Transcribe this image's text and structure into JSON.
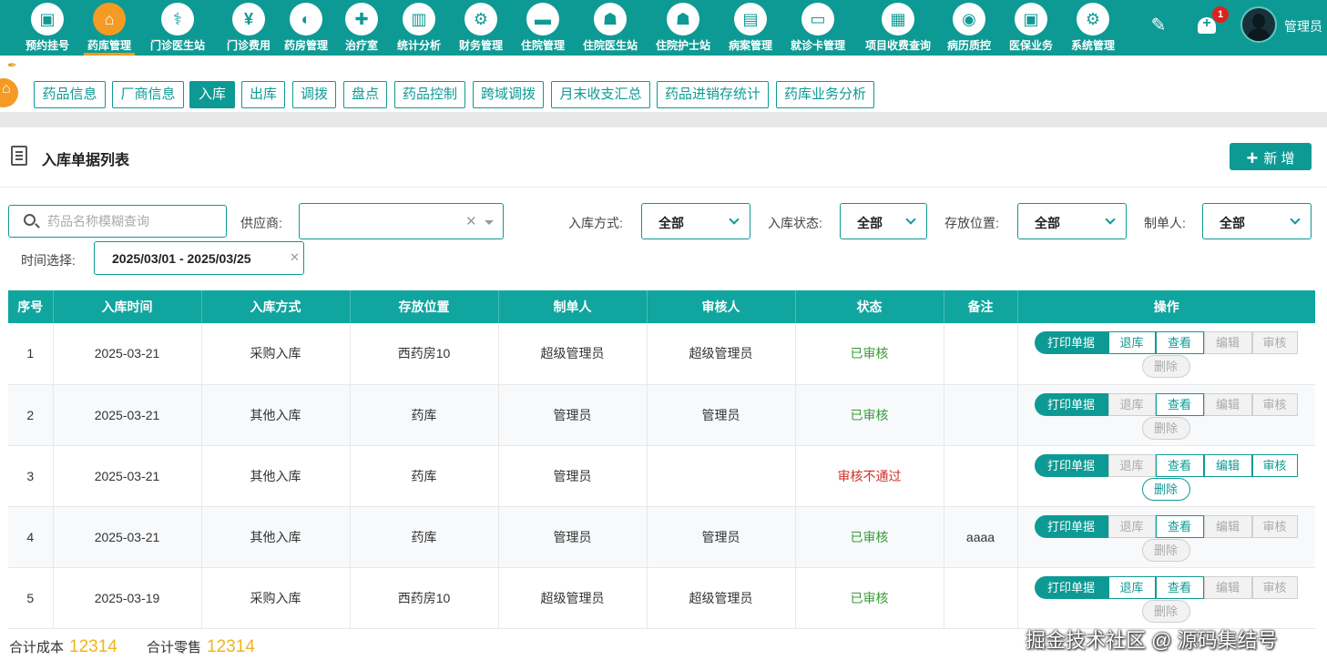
{
  "nav": {
    "items": [
      {
        "label": "预约挂号",
        "icon": "▣",
        "icon_name": "calendar-icon"
      },
      {
        "label": "药库管理",
        "icon": "⌂",
        "icon_name": "warehouse-icon",
        "active": true
      },
      {
        "label": "门诊医生站",
        "icon": "⚕",
        "icon_name": "doctor-icon"
      },
      {
        "label": "门诊费用",
        "icon": "¥",
        "icon_name": "yen-icon"
      },
      {
        "label": "药房管理",
        "icon": "◐",
        "icon_name": "pill-icon"
      },
      {
        "label": "治疗室",
        "icon": "✚",
        "icon_name": "treatment-icon"
      },
      {
        "label": "统计分析",
        "icon": "▥",
        "icon_name": "bar-chart-icon"
      },
      {
        "label": "财务管理",
        "icon": "⚙",
        "icon_name": "finance-gear-icon"
      },
      {
        "label": "住院管理",
        "icon": "▬",
        "icon_name": "bed-icon"
      },
      {
        "label": "住院医生站",
        "icon": "☗",
        "icon_name": "inpatient-doctor-icon"
      },
      {
        "label": "住院护士站",
        "icon": "☗",
        "icon_name": "nurse-icon"
      },
      {
        "label": "病案管理",
        "icon": "▤",
        "icon_name": "medical-record-icon"
      },
      {
        "label": "就诊卡管理",
        "icon": "▭",
        "icon_name": "card-icon"
      },
      {
        "label": "项目收费查询",
        "icon": "▦",
        "icon_name": "fee-query-icon"
      },
      {
        "label": "病历质控",
        "icon": "◉",
        "icon_name": "quality-control-icon"
      },
      {
        "label": "医保业务",
        "icon": "▣",
        "icon_name": "insurance-icon"
      },
      {
        "label": "系统管理",
        "icon": "⚙",
        "icon_name": "settings-icon"
      }
    ],
    "pencil_icon": "✎",
    "bell_badge": "1",
    "username": "管理员"
  },
  "subtabs": [
    {
      "label": "药品信息"
    },
    {
      "label": "厂商信息"
    },
    {
      "label": "入库",
      "active": true
    },
    {
      "label": "出库"
    },
    {
      "label": "调拨"
    },
    {
      "label": "盘点"
    },
    {
      "label": "药品控制"
    },
    {
      "label": "跨域调拨"
    },
    {
      "label": "月末收支汇总"
    },
    {
      "label": "药品进销存统计"
    },
    {
      "label": "药库业务分析"
    }
  ],
  "section": {
    "title": "入库单据列表",
    "add_label": "新 增"
  },
  "filters": {
    "search_placeholder": "药品名称模糊查询",
    "supplier_label": "供应商:",
    "supplier_value": "",
    "method_label": "入库方式:",
    "method_value": "全部",
    "status_label": "入库状态:",
    "status_value": "全部",
    "location_label": "存放位置:",
    "location_value": "全部",
    "creator_label": "制单人:",
    "creator_value": "全部",
    "date_label": "时间选择:",
    "date_value": "2025/03/01 - 2025/03/25"
  },
  "table": {
    "headers": [
      "序号",
      "入库时间",
      "入库方式",
      "存放位置",
      "制单人",
      "审核人",
      "状态",
      "备注",
      "操作"
    ],
    "ops_labels": {
      "print": "打印单据",
      "back": "退库",
      "view": "查看",
      "edit": "编辑",
      "audit": "审核",
      "del": "删除"
    },
    "rows": [
      {
        "no": "1",
        "time": "2025-03-21",
        "method": "采购入库",
        "location": "西药房10",
        "creator": "超级管理员",
        "auditor": "超级管理员",
        "status": "已审核",
        "status_ok": true,
        "note": "",
        "enabled": {
          "back": true,
          "view": true,
          "edit": false,
          "audit": false,
          "del": false
        }
      },
      {
        "no": "2",
        "time": "2025-03-21",
        "method": "其他入库",
        "location": "药库",
        "creator": "管理员",
        "auditor": "管理员",
        "status": "已审核",
        "status_ok": true,
        "note": "",
        "enabled": {
          "back": false,
          "view": true,
          "edit": false,
          "audit": false,
          "del": false
        }
      },
      {
        "no": "3",
        "time": "2025-03-21",
        "method": "其他入库",
        "location": "药库",
        "creator": "管理员",
        "auditor": "",
        "status": "审核不通过",
        "status_ok": false,
        "note": "",
        "enabled": {
          "back": false,
          "view": true,
          "edit": true,
          "audit": true,
          "del": true
        }
      },
      {
        "no": "4",
        "time": "2025-03-21",
        "method": "其他入库",
        "location": "药库",
        "creator": "管理员",
        "auditor": "管理员",
        "status": "已审核",
        "status_ok": true,
        "note": "aaaa",
        "enabled": {
          "back": false,
          "view": true,
          "edit": false,
          "audit": false,
          "del": false
        }
      },
      {
        "no": "5",
        "time": "2025-03-19",
        "method": "采购入库",
        "location": "西药房10",
        "creator": "超级管理员",
        "auditor": "超级管理员",
        "status": "已审核",
        "status_ok": true,
        "note": "",
        "enabled": {
          "back": true,
          "view": true,
          "edit": false,
          "audit": false,
          "del": false
        }
      }
    ]
  },
  "totals": {
    "cost_label": "合计成本",
    "cost_value": "12314",
    "retail_label": "合计零售",
    "retail_value": "12314"
  },
  "watermark": "掘金技术社区 @ 源码集结号",
  "colors": {
    "primary": "#0e9a94",
    "accent": "#f59a23",
    "ok": "#3a9a3a",
    "bad": "#d0302a",
    "total": "#f0b41c"
  }
}
